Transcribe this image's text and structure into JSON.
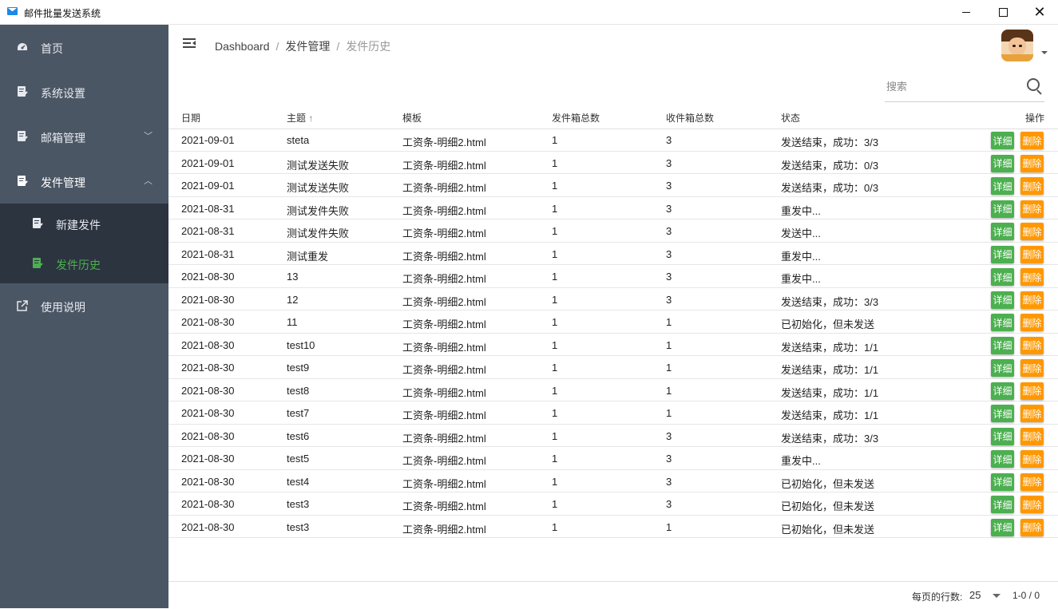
{
  "window": {
    "title": "邮件批量发送系统",
    "minimize": "",
    "maximize": "",
    "close": "✕"
  },
  "sidebar": {
    "items": [
      {
        "label": "首页",
        "icon": "dashboard-icon"
      },
      {
        "label": "系统设置",
        "icon": "document-edit-icon"
      },
      {
        "label": "邮箱管理",
        "icon": "document-edit-icon",
        "chevron": "﹀"
      },
      {
        "label": "发件管理",
        "icon": "document-edit-icon",
        "chevron": "︿"
      },
      {
        "label": "使用说明",
        "icon": "external-link-icon"
      }
    ],
    "submenu": [
      {
        "label": "新建发件",
        "icon": "document-edit-icon"
      },
      {
        "label": "发件历史",
        "icon": "document-edit-icon"
      }
    ]
  },
  "header": {
    "breadcrumb": [
      "Dashboard",
      "发件管理",
      "发件历史"
    ],
    "separator": "/"
  },
  "search": {
    "placeholder": "搜索",
    "value": ""
  },
  "table": {
    "columns": [
      "日期",
      "主题",
      "模板",
      "发件箱总数",
      "收件箱总数",
      "状态",
      "操作"
    ],
    "sort_indicator": "↑",
    "detail_label": "详细",
    "delete_label": "删除",
    "rows": [
      [
        "2021-09-01",
        "steta",
        "工资条-明细2.html",
        "1",
        "3",
        "发送结束，成功：3/3"
      ],
      [
        "2021-09-01",
        "测试发送失败",
        "工资条-明细2.html",
        "1",
        "3",
        "发送结束，成功：0/3"
      ],
      [
        "2021-09-01",
        "测试发送失败",
        "工资条-明细2.html",
        "1",
        "3",
        "发送结束，成功：0/3"
      ],
      [
        "2021-08-31",
        "测试发件失败",
        "工资条-明细2.html",
        "1",
        "3",
        "重发中..."
      ],
      [
        "2021-08-31",
        "测试发件失败",
        "工资条-明细2.html",
        "1",
        "3",
        "发送中..."
      ],
      [
        "2021-08-31",
        "测试重发",
        "工资条-明细2.html",
        "1",
        "3",
        "重发中..."
      ],
      [
        "2021-08-30",
        "13",
        "工资条-明细2.html",
        "1",
        "3",
        "重发中..."
      ],
      [
        "2021-08-30",
        "12",
        "工资条-明细2.html",
        "1",
        "3",
        "发送结束，成功：3/3"
      ],
      [
        "2021-08-30",
        "11",
        "工资条-明细2.html",
        "1",
        "1",
        "已初始化，但未发送"
      ],
      [
        "2021-08-30",
        "test10",
        "工资条-明细2.html",
        "1",
        "1",
        "发送结束，成功：1/1"
      ],
      [
        "2021-08-30",
        "test9",
        "工资条-明细2.html",
        "1",
        "1",
        "发送结束，成功：1/1"
      ],
      [
        "2021-08-30",
        "test8",
        "工资条-明细2.html",
        "1",
        "1",
        "发送结束，成功：1/1"
      ],
      [
        "2021-08-30",
        "test7",
        "工资条-明细2.html",
        "1",
        "1",
        "发送结束，成功：1/1"
      ],
      [
        "2021-08-30",
        "test6",
        "工资条-明细2.html",
        "1",
        "3",
        "发送结束，成功：3/3"
      ],
      [
        "2021-08-30",
        "test5",
        "工资条-明细2.html",
        "1",
        "3",
        "重发中..."
      ],
      [
        "2021-08-30",
        "test4",
        "工资条-明细2.html",
        "1",
        "3",
        "已初始化，但未发送"
      ],
      [
        "2021-08-30",
        "test3",
        "工资条-明细2.html",
        "1",
        "3",
        "已初始化，但未发送"
      ],
      [
        "2021-08-30",
        "test3",
        "工资条-明细2.html",
        "1",
        "1",
        "已初始化，但未发送"
      ]
    ]
  },
  "footer": {
    "rows_per_page_label": "每页的行数:",
    "rows_per_page": "25",
    "page_range": "1-0 / 0"
  },
  "colors": {
    "sidebar": "#4b5665",
    "submenu": "#2c3440",
    "accent": "#4caf50",
    "detail": "#4caf50",
    "delete": "#ff9800"
  }
}
